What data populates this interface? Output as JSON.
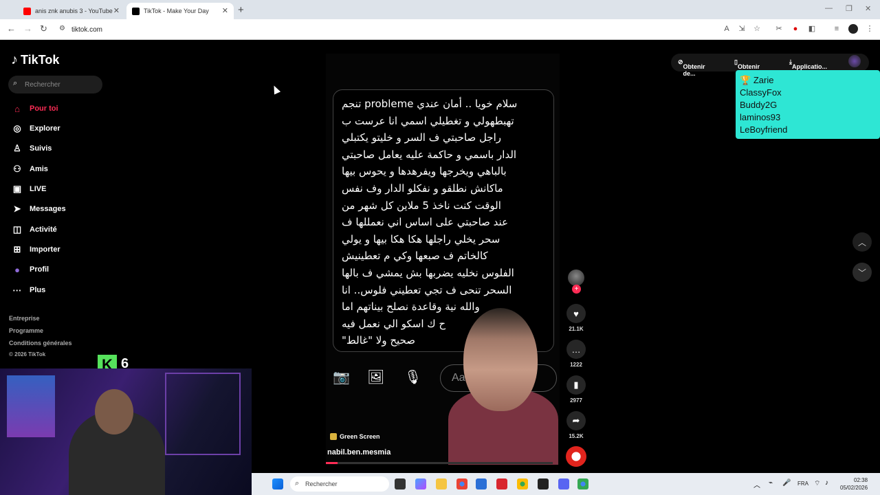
{
  "browser": {
    "tabs": [
      {
        "label": "anis znk anubis 3 - YouTube",
        "favicon_color": "#ff0000"
      },
      {
        "label": "TikTok - Make Your Day",
        "favicon_color": "#000000"
      }
    ],
    "url": "tiktok.com"
  },
  "sidebar": {
    "logo": "TikTok",
    "search_placeholder": "Rechercher",
    "items": [
      {
        "label": "Pour toi",
        "icon": "home-icon",
        "active": true
      },
      {
        "label": "Explorer",
        "icon": "compass-icon"
      },
      {
        "label": "Suivis",
        "icon": "following-icon"
      },
      {
        "label": "Amis",
        "icon": "friends-icon"
      },
      {
        "label": "LIVE",
        "icon": "live-icon"
      },
      {
        "label": "Messages",
        "icon": "messages-icon"
      },
      {
        "label": "Activité",
        "icon": "activity-icon"
      },
      {
        "label": "Importer",
        "icon": "upload-icon"
      },
      {
        "label": "Profil",
        "icon": "profile-icon"
      },
      {
        "label": "Plus",
        "icon": "more-icon"
      }
    ],
    "footer": [
      "Entreprise",
      "Programme",
      "Conditions générales",
      "© 2026 TikTok"
    ]
  },
  "topbar": {
    "coins": "Obtenir de...",
    "app": "Obtenir l'a...",
    "download": "Applicatio..."
  },
  "overlay_list": [
    "Zarie",
    "ClassyFox",
    "Buddy2G",
    "laminos93",
    "LeBoyfriend"
  ],
  "video": {
    "message_lines": [
      "سلام خويا .. أمان عندي probleme تنجم",
      "تهبطهولي و تغطيلي اسمي انا عرست ب",
      "راجل صاحبتي ف السر و خليتو يكتبلي",
      "الدار باسمي و حاكمة عليه يعامل صاحبتي",
      "بالباهي ويخرجها ويفرهدها و يحوس بيها",
      "ماكانش نطلقو و نفكلو الدار وف نفس",
      "الوقت كنت ناخذ 5 ملاين كل شهر من",
      "عند صاحبتي على اساس اني نعمللها ف",
      "سحر يخلي راجلها هكا هكا بيها و يولي",
      "كالخاتم ف صبعها وكي م تعطينيش",
      "الفلوس نخليه يضربها بش يمشي ف بالها",
      "السحر تنحى ف تجي تعطيني فلوس.. انا",
      "والله نية      وقاعدة نصلح بيناتهم اما",
      "ح          ك اسكو الي نعمل فيه",
      "صحيح ولا \"غالط\""
    ],
    "input_placeholder": "Aa",
    "effect_label": "Green Screen",
    "author": "nabil.ben.mesmia",
    "progress": 0.05
  },
  "actions": {
    "likes": "21.1K",
    "comments": "1222",
    "saves": "2977",
    "shares": "15.2K"
  },
  "stream": {
    "badge_letter": "K",
    "badge_count": "6"
  },
  "taskbar": {
    "search": "Rechercher",
    "lang": "FRA",
    "time": "02:38",
    "date": "05/02/2026"
  }
}
